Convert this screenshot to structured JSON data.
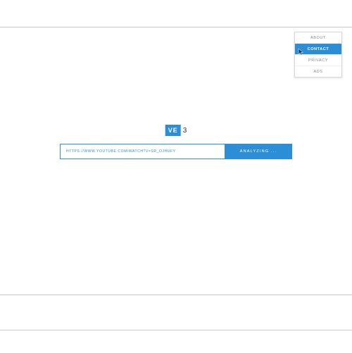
{
  "menu": {
    "items": [
      {
        "label": "About",
        "active": false
      },
      {
        "label": "Contact",
        "active": true
      },
      {
        "label": "Privacy",
        "active": false
      },
      {
        "label": "Ads",
        "active": false
      }
    ]
  },
  "logo": {
    "prefix": "VE",
    "suffix": "3"
  },
  "search": {
    "value": "https://www.youtube.com/watch?v=sr_ojhufy",
    "button_label": "Analyzing ..."
  },
  "colors": {
    "accent": "#2b8ed7"
  }
}
